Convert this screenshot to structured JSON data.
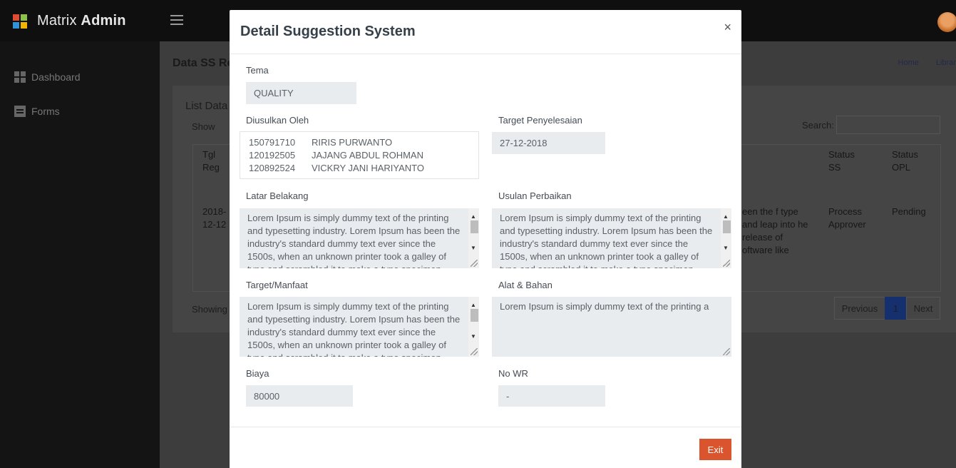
{
  "app": {
    "brand_light": "Matrix",
    "brand_bold": "Admin"
  },
  "sidebar": {
    "items": [
      {
        "label": "Dashboard"
      },
      {
        "label": "Forms"
      }
    ]
  },
  "page": {
    "title": "Data SS Re",
    "breadcrumbs": [
      "Home",
      "Librar"
    ]
  },
  "card": {
    "title": "List Data",
    "show_label": "Show",
    "search_label": "Search:",
    "columns": [
      "Tgl Reg",
      "Status SS",
      "Status OPL"
    ],
    "row": {
      "date": "2018-12-12",
      "text": "een the f type and leap into he release of oftware like",
      "status_ss": "Process Approver",
      "status_opl": "Pending"
    },
    "showing_label": "Showing",
    "pager": {
      "previous": "Previous",
      "page": "1",
      "next": "Next"
    }
  },
  "modal": {
    "title": "Detail Suggestion System",
    "close": "×",
    "tema": {
      "label": "Tema",
      "value": "QUALITY"
    },
    "diusulkan_oleh": {
      "label": "Diusulkan Oleh",
      "people": [
        {
          "id": "150791710",
          "name": "RIRIS PURWANTO"
        },
        {
          "id": "120192505",
          "name": "JAJANG ABDUL ROHMAN"
        },
        {
          "id": "120892524",
          "name": "VICKRY JANI HARIYANTO"
        }
      ]
    },
    "target_penyelesaian": {
      "label": "Target Penyelesaian",
      "value": "27-12-2018"
    },
    "latar_belakang": {
      "label": "Latar Belakang",
      "value": "Lorem Ipsum is simply dummy text of the printing and typesetting industry. Lorem Ipsum has been the industry's standard dummy text ever since the 1500s, when an unknown printer took a galley of type and scrambled it to make a type specimen book."
    },
    "usulan_perbaikan": {
      "label": "Usulan Perbaikan",
      "value": "Lorem Ipsum is simply dummy text of the printing and typesetting industry. Lorem Ipsum has been the industry's standard dummy text ever since the 1500s, when an unknown printer took a galley of type and scrambled it to make a type specimen book."
    },
    "target_manfaat": {
      "label": "Target/Manfaat",
      "value": "Lorem Ipsum is simply dummy text of the printing and typesetting industry. Lorem Ipsum has been the industry's standard dummy text ever since the 1500s, when an unknown printer took a galley of type and scrambled it to make a type specimen book."
    },
    "alat_bahan": {
      "label": "Alat & Bahan",
      "value": "Lorem Ipsum is simply dummy text of the printing a"
    },
    "biaya": {
      "label": "Biaya",
      "value": "80000"
    },
    "no_wr": {
      "label": "No WR",
      "value": "-"
    },
    "exit_label": "Exit"
  },
  "colors": {
    "accent": "#da542e",
    "logo": [
      "#e04b31",
      "#8bc34a",
      "#2f93d9",
      "#f3b400"
    ]
  }
}
